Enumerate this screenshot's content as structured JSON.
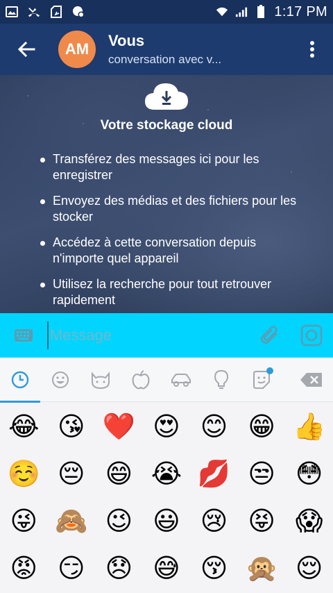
{
  "status_bar": {
    "time": "1:17 PM",
    "left_icons": [
      "gallery-icon",
      "missed-call-icon",
      "sd-card-icon",
      "settings-bubble-icon"
    ],
    "right_icons": [
      "wifi-icon",
      "signal-icon",
      "battery-icon"
    ]
  },
  "header": {
    "avatar_initials": "AM",
    "avatar_color": "#f08a4b",
    "title": "Vous",
    "subtitle": "conversation avec v..."
  },
  "cloud_info": {
    "title": "Votre stockage cloud",
    "bullets": [
      "Transférez des messages ici pour les enregistrer",
      "Envoyez des médias et des fichiers pour les stocker",
      "Accédez à cette conversation depuis n'importe quel appareil",
      "Utilisez la recherche pour tout retrouver rapidement"
    ]
  },
  "composer": {
    "placeholder": "Message",
    "bar_color": "#00d4ff"
  },
  "emoji_tabs": [
    "recent-icon",
    "smiley-icon",
    "cat-icon",
    "apple-icon",
    "car-icon",
    "lightbulb-icon",
    "sticker-icon",
    "backspace-icon"
  ],
  "emoji_rows": [
    [
      "😂",
      "😘",
      "❤️",
      "😍",
      "😊",
      "😁",
      "👍"
    ],
    [
      "☺️",
      "😔",
      "😄",
      "😭",
      "💋",
      "😒",
      "😳"
    ],
    [
      "😜",
      "🙈",
      "😉",
      "😃",
      "😢",
      "😝",
      "😱"
    ],
    [
      "😡",
      "😏",
      "😞",
      "😅",
      "😚",
      "🙊",
      "😌"
    ]
  ],
  "colors": {
    "status_bar": "#17305c",
    "app_bar": "#1d3b6e",
    "accent": "#2f9bd8"
  }
}
